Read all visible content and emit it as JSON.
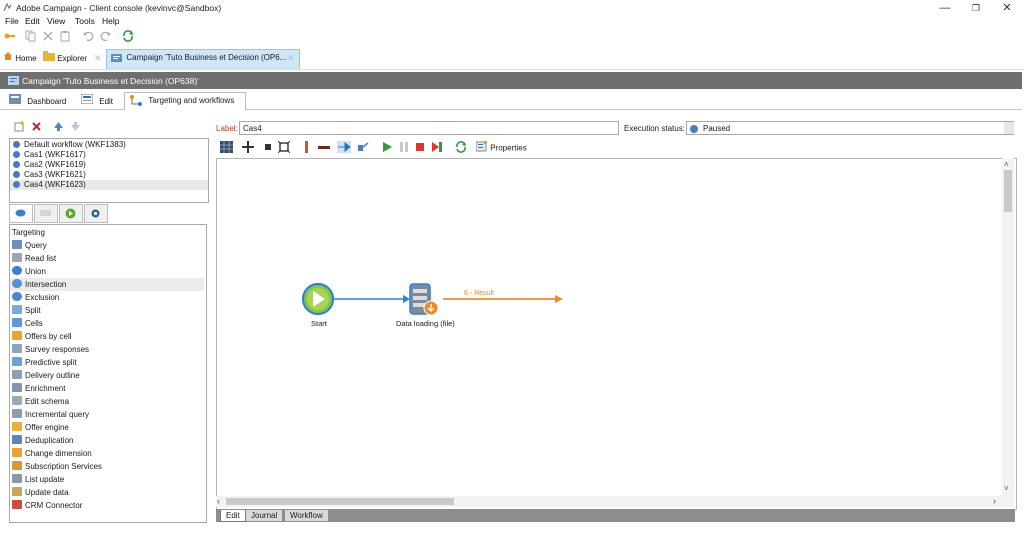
{
  "window": {
    "title": "Adobe Campaign - Client console (kevinvc@Sandbox)",
    "minimize": "—",
    "maximize": "❐",
    "close": "✕"
  },
  "menu": [
    "File",
    "Edit",
    "View",
    "Tools",
    "Help"
  ],
  "doc_tabs": {
    "home": "Home",
    "explorer": "Explorer",
    "campaign": "Campaign 'Tuto Business et Decision (OP6..."
  },
  "campaign_header": "Campaign 'Tuto Business et Decision (OP638)'",
  "sub_tabs": {
    "dashboard": "Dashboard",
    "edit": "Edit",
    "targeting": "Targeting and workflows"
  },
  "workflows": [
    "Default workflow (WKF1383)",
    "Cas1 (WKF1617)",
    "Cas2 (WKF1619)",
    "Cas3 (WKF1621)",
    "Cas4 (WKF1623)"
  ],
  "activities": [
    {
      "label": "Targeting",
      "icon": "none"
    },
    {
      "label": "Query",
      "icon": "query-icon"
    },
    {
      "label": "Read list",
      "icon": "read-list-icon"
    },
    {
      "label": "Union",
      "icon": "union-icon"
    },
    {
      "label": "Intersection",
      "icon": "intersection-icon"
    },
    {
      "label": "Exclusion",
      "icon": "exclusion-icon"
    },
    {
      "label": "Split",
      "icon": "split-icon"
    },
    {
      "label": "Cells",
      "icon": "cells-icon"
    },
    {
      "label": "Offers by cell",
      "icon": "offers-icon"
    },
    {
      "label": "Survey responses",
      "icon": "survey-icon"
    },
    {
      "label": "Predictive split",
      "icon": "predictive-icon"
    },
    {
      "label": "Delivery outline",
      "icon": "delivery-icon"
    },
    {
      "label": "Enrichment",
      "icon": "enrichment-icon"
    },
    {
      "label": "Edit schema",
      "icon": "schema-icon"
    },
    {
      "label": "Incremental query",
      "icon": "incremental-icon"
    },
    {
      "label": "Offer engine",
      "icon": "offer-engine-icon"
    },
    {
      "label": "Deduplication",
      "icon": "dedup-icon"
    },
    {
      "label": "Change dimension",
      "icon": "dimension-icon"
    },
    {
      "label": "Subscription Services",
      "icon": "subscription-icon"
    },
    {
      "label": "List update",
      "icon": "list-update-icon"
    },
    {
      "label": "Update data",
      "icon": "update-data-icon"
    },
    {
      "label": "CRM Connector",
      "icon": "crm-icon"
    }
  ],
  "form": {
    "label_caption": "Label:",
    "label_value": "Cas4",
    "exec_caption": "Execution status:",
    "exec_value": "Paused"
  },
  "toolbar": {
    "properties": "Properties"
  },
  "canvas": {
    "start_label": "Start",
    "loading_label": "Data loading (file)",
    "transition_label": "6 - Result"
  },
  "bottom_tabs": [
    "Edit",
    "Journal",
    "Workflow"
  ],
  "colors": {
    "start_green": "#8cc63f",
    "node_blue": "#2f80d9",
    "transition_orange": "#f0882c",
    "header_grey": "#6f6f6f",
    "label_red": "#c43c1a"
  }
}
